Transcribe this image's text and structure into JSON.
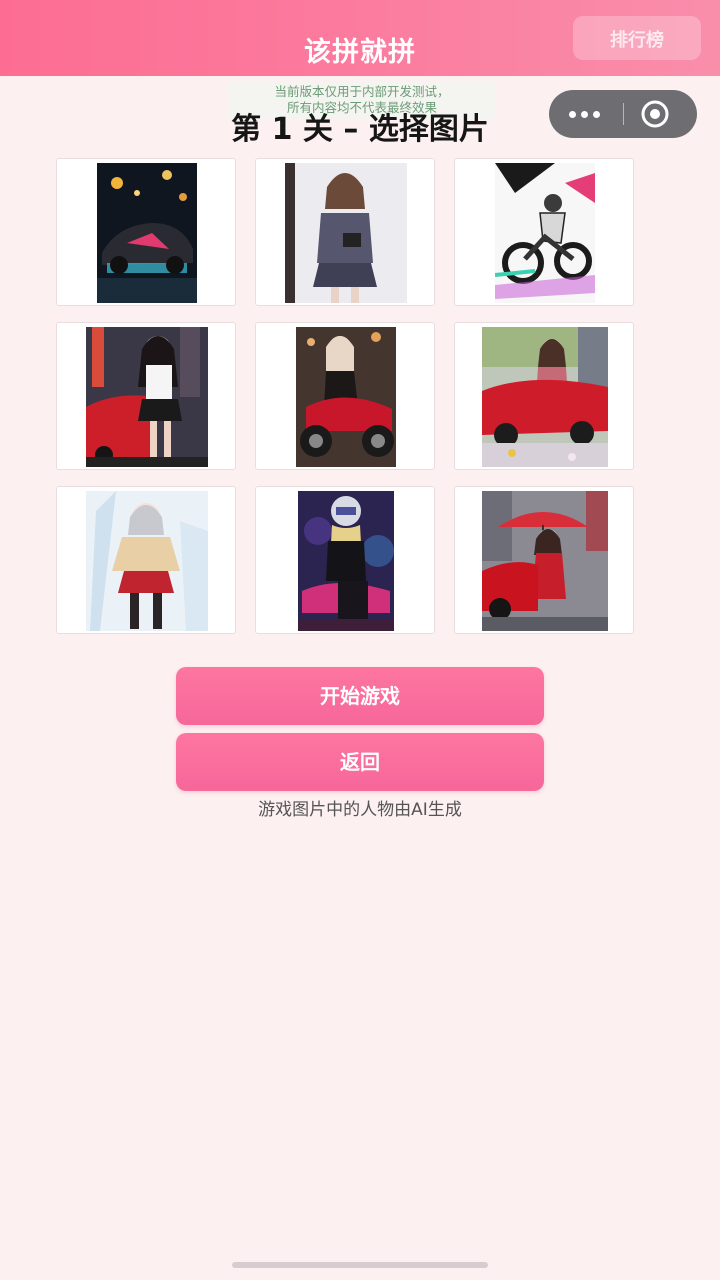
{
  "app_title": "该拼就拼",
  "rank_button_label": "排行榜",
  "capsule": {
    "more_icon": "more-dots-icon",
    "close_icon": "target-close-icon"
  },
  "notice": {
    "line1": "当前版本仅用于内部开发测试，",
    "line2": "所有内容均不代表最终效果"
  },
  "level_title": "第 1 关 – 选择图片",
  "images": [
    {
      "name": "night-sports-car"
    },
    {
      "name": "girl-in-uniform"
    },
    {
      "name": "motorcycle-sketch"
    },
    {
      "name": "girl-with-red-car-city"
    },
    {
      "name": "girl-on-red-motorcycle"
    },
    {
      "name": "girl-on-red-car-flowers"
    },
    {
      "name": "girl-in-red-skirt"
    },
    {
      "name": "helmet-girl-on-motorcycle"
    },
    {
      "name": "girl-with-red-umbrella"
    }
  ],
  "buttons": {
    "start": "开始游戏",
    "back": "返回"
  },
  "footnote": "游戏图片中的人物由AI生成",
  "colors": {
    "header_start": "#fd6d93",
    "header_end": "#f98eab",
    "button_pink": "#f6679a",
    "page_background": "#fcf0f1"
  }
}
